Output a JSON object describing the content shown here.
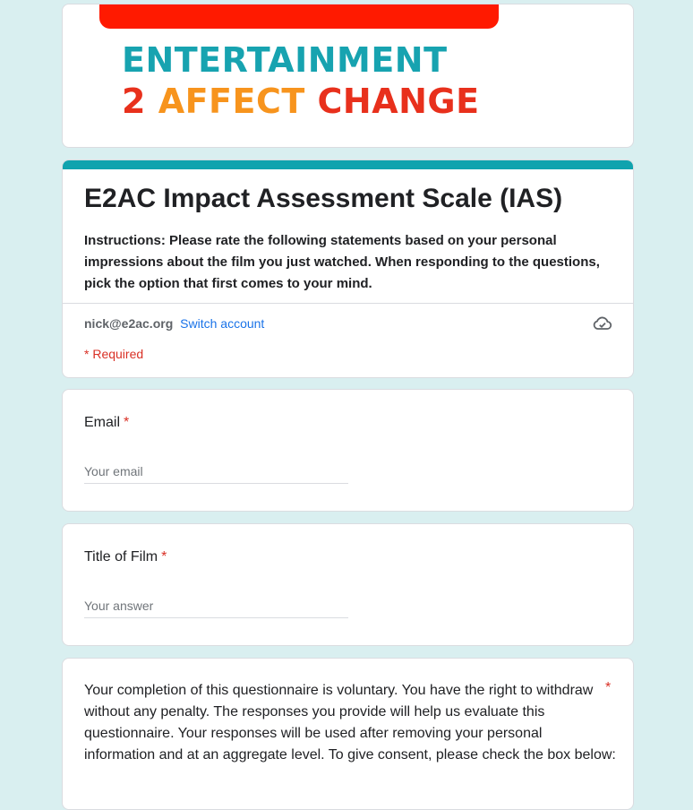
{
  "banner": {
    "line1": "ENTERTAINMENT",
    "line2_number": "2",
    "line2_word1": "AFFECT",
    "line2_word2": "CHANGE",
    "colors": {
      "teal": "#17a3b0",
      "orange": "#f7941d",
      "red": "#e8301c",
      "bar": "#ff1a00"
    }
  },
  "form": {
    "title": "E2AC Impact Assessment Scale (IAS)",
    "description": "Instructions: Please rate the following statements based on your personal impressions about the film you just watched. When responding to the questions, pick the option that first comes to your mind.",
    "accent_color": "#10a3ae"
  },
  "account": {
    "email": "nick@e2ac.org",
    "switch_label": "Switch account",
    "cloud_icon": "cloud-saved-icon"
  },
  "required_note": "* Required",
  "questions": {
    "email": {
      "label": "Email",
      "required_mark": "*",
      "placeholder": "Your email",
      "value": ""
    },
    "film_title": {
      "label": "Title of Film",
      "required_mark": "*",
      "placeholder": "Your answer",
      "value": ""
    },
    "consent": {
      "text": "Your completion of this questionnaire is voluntary. You have the right to withdraw without any penalty. The responses you provide will help us evaluate this questionnaire. Your responses will be used after removing your personal information and at an aggregate level. To give consent, please check the box below:",
      "required_mark": "*"
    }
  }
}
